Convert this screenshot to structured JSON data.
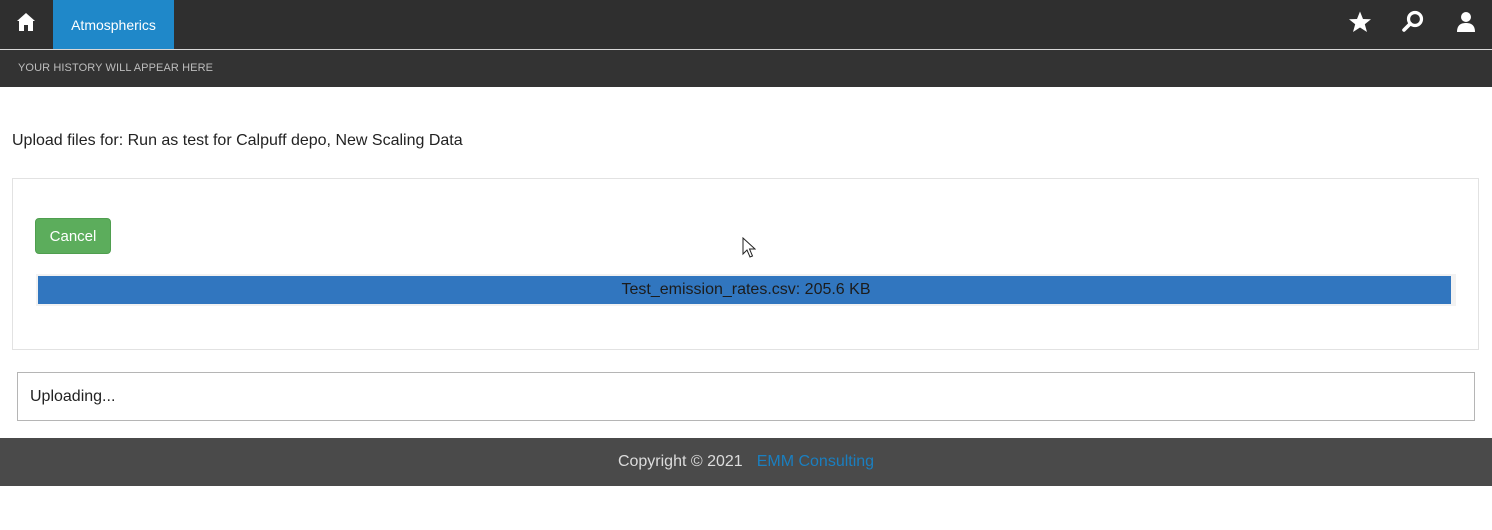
{
  "nav": {
    "home_icon": "home-icon",
    "active_tab_label": "Atmospherics",
    "icons": [
      "star-icon",
      "search-icon",
      "user-icon"
    ]
  },
  "history": {
    "text": "YOUR HISTORY WILL APPEAR HERE"
  },
  "upload": {
    "title": "Upload files for: Run as test for Calpuff depo, New Scaling Data",
    "cancel_label": "Cancel",
    "file_label": "Test_emission_rates.csv: 205.6 KB",
    "progress_fraction": 1.0,
    "status_text": "Uploading..."
  },
  "footer": {
    "copyright": "Copyright © 2021",
    "link_text": "EMM Consulting"
  },
  "colors": {
    "topbar": "#2f2f2f",
    "active_tab": "#1f88c9",
    "progress": "#3176bf",
    "cancel_button": "#5cad5c",
    "footer": "#4a4a4a",
    "footer_link": "#1a7fc0"
  }
}
